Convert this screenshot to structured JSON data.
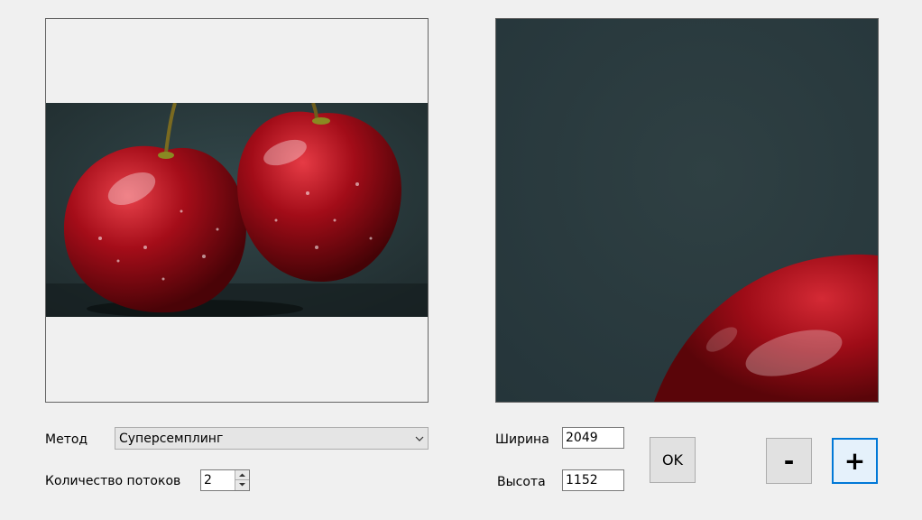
{
  "source_panel": {
    "image_description": "two red cherries with water droplets on a dark teal background"
  },
  "result_panel": {
    "image_description": "zoomed portion showing dark teal background and top of a red cherry"
  },
  "method": {
    "label": "Метод",
    "selected": "Суперсемплинг"
  },
  "threads": {
    "label": "Количество потоков",
    "value": "2"
  },
  "size": {
    "width_label": "Ширина",
    "width_value": "2049",
    "height_label": "Высота",
    "height_value": "1152"
  },
  "buttons": {
    "ok": "OK",
    "zoom_out": "-",
    "zoom_in": "+"
  },
  "colors": {
    "form_background": "#f0f0f0",
    "image_background": "#2b3b3e",
    "cherry_red": "#a3101a",
    "focus_border": "#0078d7"
  }
}
